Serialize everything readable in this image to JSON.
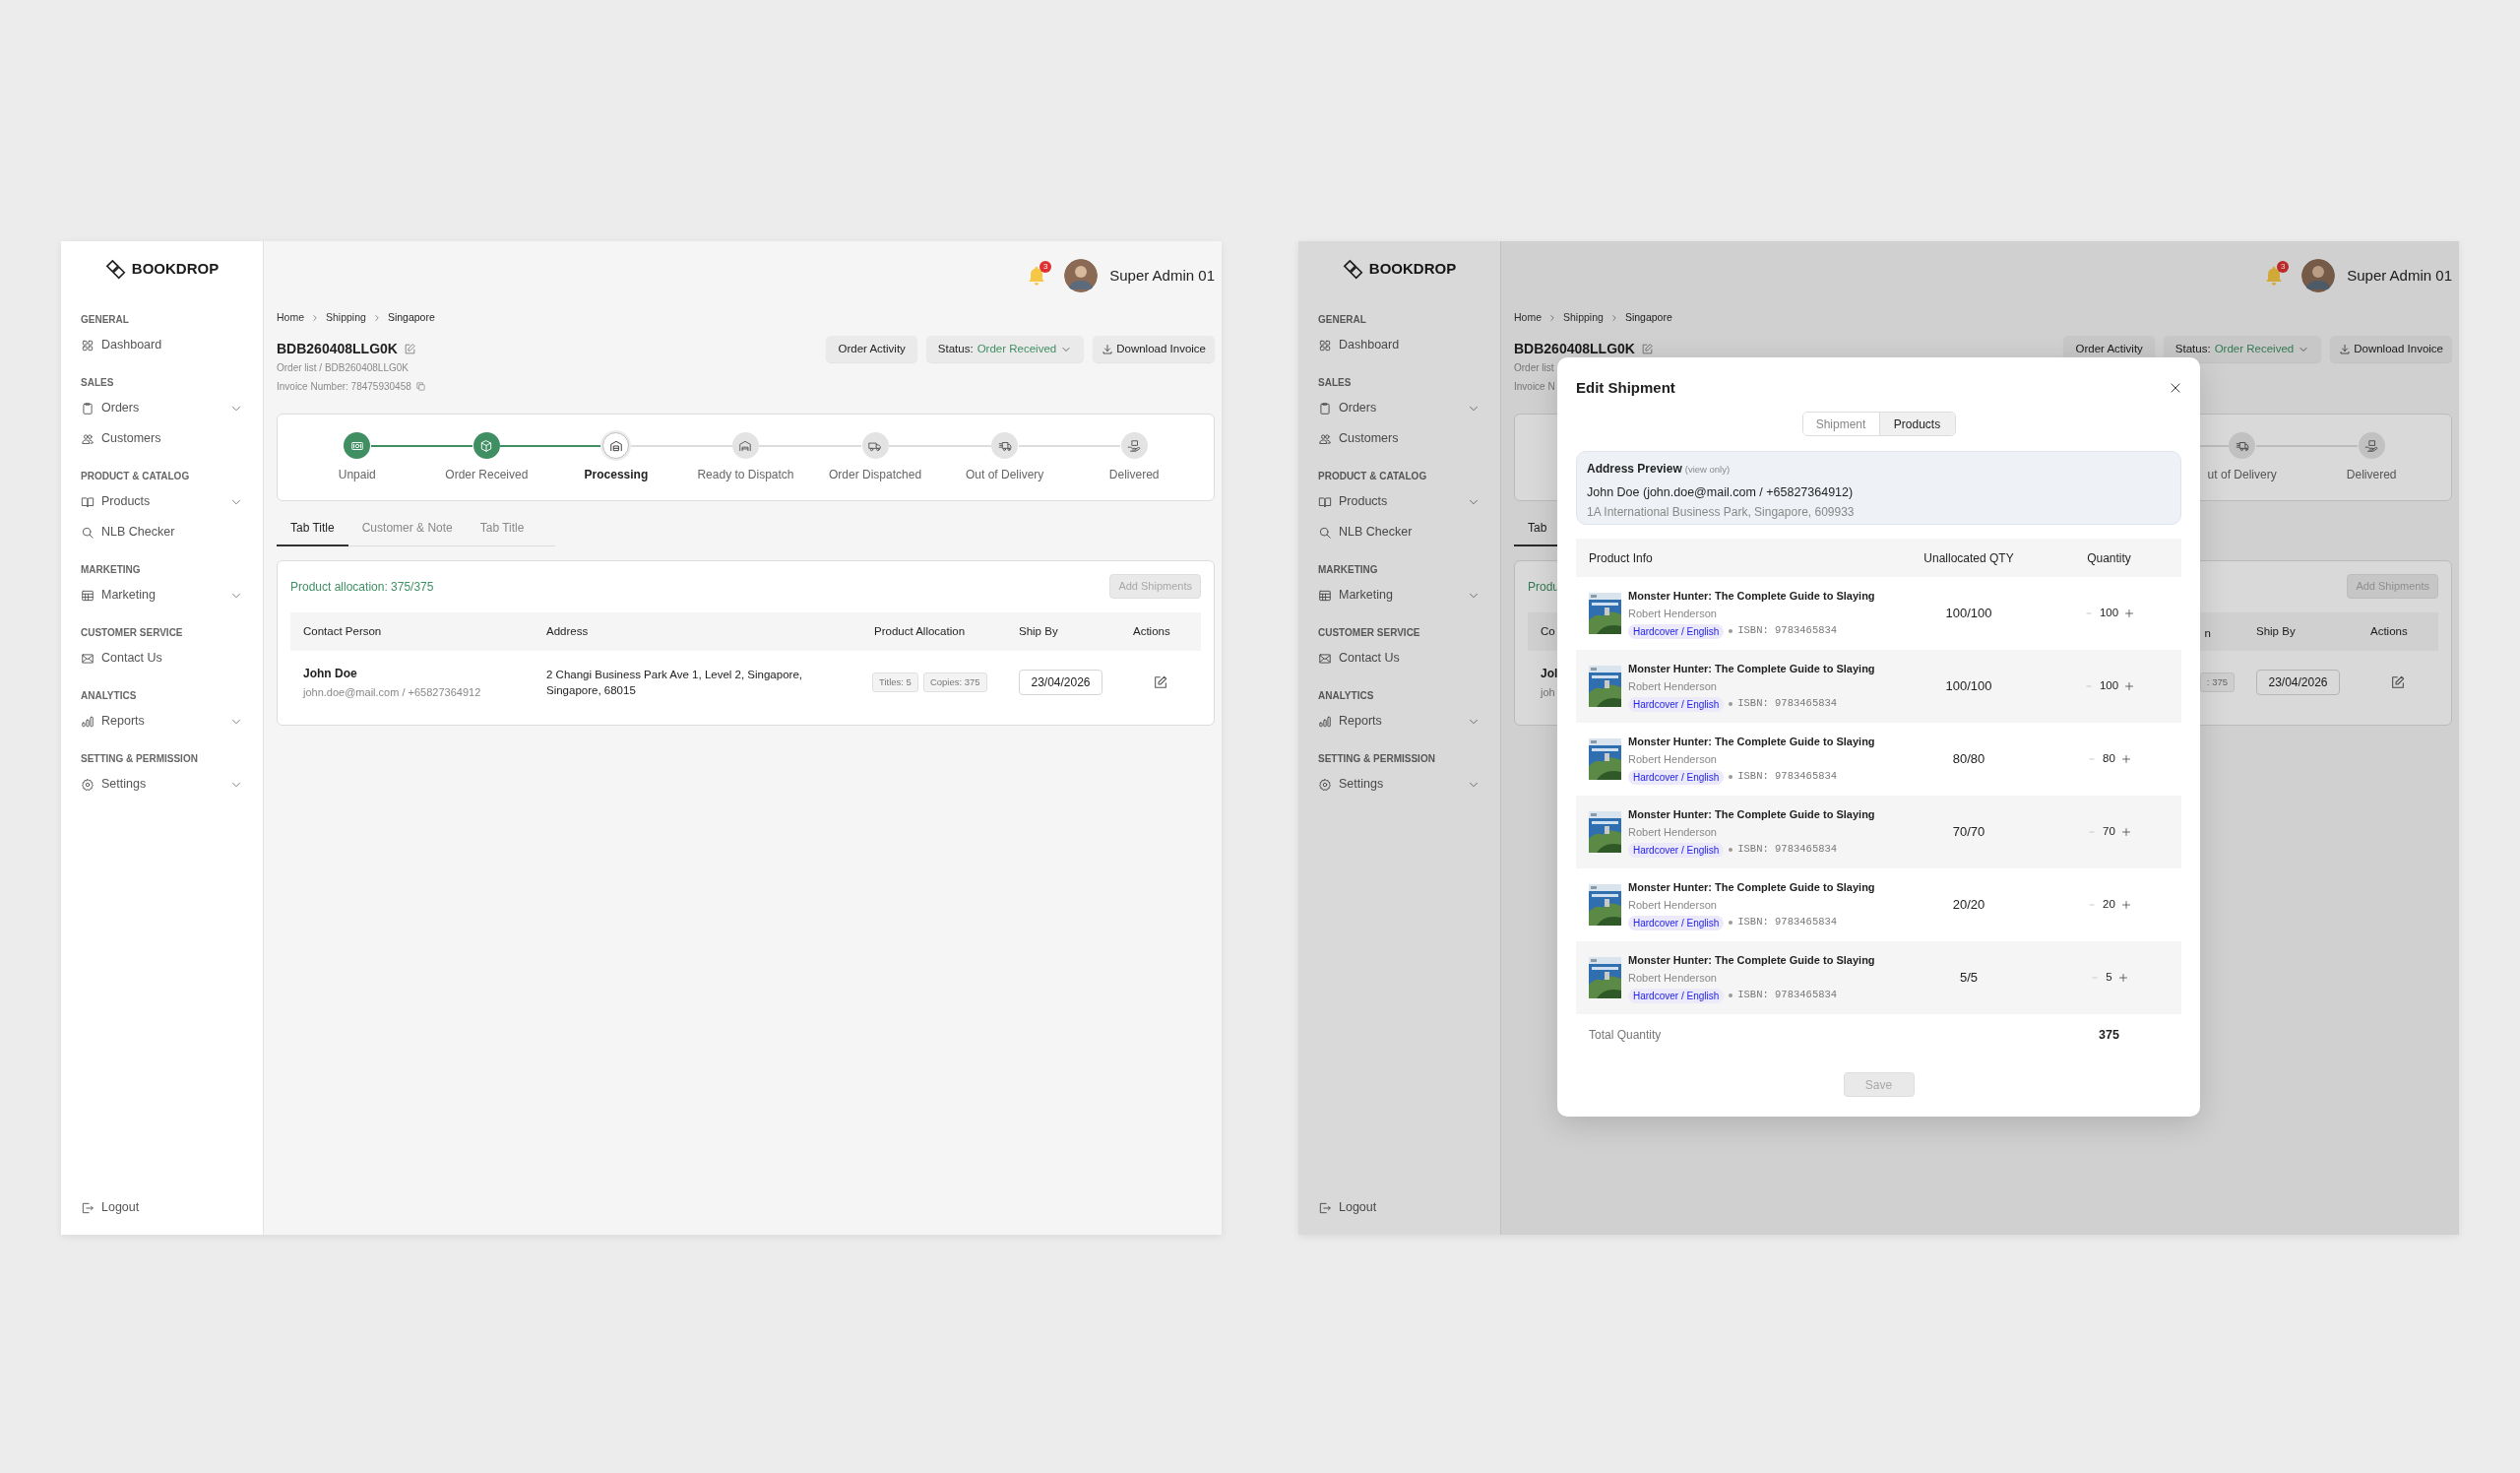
{
  "left_screen": {
    "sidebar": {
      "logo": "BOOKDROP",
      "sections": [
        {
          "title": "GENERAL",
          "items": [
            {
              "label": "Dashboard",
              "expandable": false
            }
          ]
        },
        {
          "title": "SALES",
          "items": [
            {
              "label": "Orders",
              "expandable": true
            },
            {
              "label": "Customers",
              "expandable": false
            }
          ]
        },
        {
          "title": "PRODUCT & CATALOG",
          "items": [
            {
              "label": "Products",
              "expandable": true
            },
            {
              "label": "NLB Checker",
              "expandable": false
            }
          ]
        },
        {
          "title": "MARKETING",
          "items": [
            {
              "label": "Marketing",
              "expandable": true
            }
          ]
        },
        {
          "title": "CUSTOMER SERVICE",
          "items": [
            {
              "label": "Contact Us",
              "expandable": false
            }
          ]
        },
        {
          "title": "ANALYTICS",
          "items": [
            {
              "label": "Reports",
              "expandable": true
            }
          ]
        },
        {
          "title": "SETTING & PERMISSION",
          "items": [
            {
              "label": "Settings",
              "expandable": true
            }
          ]
        }
      ],
      "logout": "Logout"
    },
    "header": {
      "notification_count": "3",
      "user_name": "Super Admin 01"
    },
    "breadcrumb": [
      "Home",
      "Shipping",
      "Singapore"
    ],
    "order": {
      "id": "BDB260408LLG0K",
      "path": "Order list / BDB260408LLG0K",
      "invoice": "Invoice Number: 78475930458"
    },
    "actions": {
      "order_activity": "Order Activity",
      "status_label": "Status:",
      "status_value": "Order Received",
      "download": "Download Invoice"
    },
    "steps": [
      {
        "label": "Unpaid",
        "completed": true,
        "active": false
      },
      {
        "label": "Order Received",
        "completed": true,
        "active": false
      },
      {
        "label": "Processing",
        "completed": false,
        "active": true
      },
      {
        "label": "Ready to Dispatch",
        "completed": false,
        "active": false
      },
      {
        "label": "Order Dispatched",
        "completed": false,
        "active": false
      },
      {
        "label": "Out of Delivery",
        "completed": false,
        "active": false
      },
      {
        "label": "Delivered",
        "completed": false,
        "active": false
      }
    ],
    "tabs": [
      {
        "label": "Tab Title",
        "selected": true
      },
      {
        "label": "Customer & Note",
        "selected": false
      },
      {
        "label": "Tab Title",
        "selected": false
      }
    ],
    "allocation": {
      "summary": "Product allocation: 375/375",
      "add_button": "Add Shipments",
      "add_disabled": true
    },
    "table": {
      "columns": [
        "Contact Person",
        "Address",
        "Product Allocation",
        "Ship By",
        "Actions"
      ],
      "rows": [
        {
          "name": "John Doe",
          "contact": "john.doe@mail.com / +65827364912",
          "address": "2 Changi Business Park Ave 1, Level 2, Singapore, Singapore, 68015",
          "titles": "Titles: 5",
          "copies": "Copies: 375",
          "ship_by": "23/04/2026"
        }
      ]
    }
  },
  "right_screen": {
    "sidebar": {
      "logo": "BOOKDROP",
      "sections": [
        {
          "title": "GENERAL",
          "items": [
            {
              "label": "Dashboard",
              "expandable": false
            }
          ]
        },
        {
          "title": "SALES",
          "items": [
            {
              "label": "Orders",
              "expandable": true
            },
            {
              "label": "Customers",
              "expandable": false
            }
          ]
        },
        {
          "title": "PRODUCT & CATALOG",
          "items": [
            {
              "label": "Products",
              "expandable": true
            },
            {
              "label": "NLB Checker",
              "expandable": false
            }
          ]
        },
        {
          "title": "MARKETING",
          "items": [
            {
              "label": "Marketing",
              "expandable": true
            }
          ]
        },
        {
          "title": "CUSTOMER SERVICE",
          "items": [
            {
              "label": "Contact Us",
              "expandable": false
            }
          ]
        },
        {
          "title": "ANALYTICS",
          "items": [
            {
              "label": "Reports",
              "expandable": true
            }
          ]
        },
        {
          "title": "SETTING & PERMISSION",
          "items": [
            {
              "label": "Settings",
              "expandable": true
            }
          ]
        }
      ],
      "logout": "Logout"
    },
    "header": {
      "notification_count": "3",
      "user_name": "Super Admin 01"
    },
    "breadcrumb": [
      "Home",
      "Shipping",
      "Singapore"
    ],
    "order": {
      "id": "BDB260408LLG0K",
      "path": "Order list",
      "invoice": "Invoice N"
    },
    "actions": {
      "order_activity": "Order Activity",
      "status_label": "Status:",
      "status_value": "Order Received",
      "download": "Download Invoice"
    },
    "steps": [
      {
        "label": "ut of Delivery",
        "completed": false,
        "active": false
      },
      {
        "label": "Delivered",
        "completed": false,
        "active": false
      }
    ],
    "tabs": [
      {
        "label": "Tab",
        "selected": true
      }
    ],
    "allocation": {
      "summary": "Produ",
      "add_button": "Add Shipments",
      "add_disabled": true
    },
    "table": {
      "columns": [
        "Co",
        "n",
        "Ship By",
        "Actions"
      ],
      "rows": [
        {
          "name": "Jol",
          "contact": "joh",
          "copies": ": 375",
          "ship_by": "23/04/2026"
        }
      ]
    },
    "modal": {
      "title": "Edit Shipment",
      "segments": [
        {
          "label": "Shipment",
          "selected": false
        },
        {
          "label": "Products",
          "selected": true
        }
      ],
      "address_preview": {
        "title": "Address Preview",
        "note": "(view only)",
        "contact": "John Doe (john.doe@mail.com / +65827364912)",
        "address": "1A International Business Park, Singapore, 609933"
      },
      "columns": [
        "Product Info",
        "Unallocated QTY",
        "Quantity"
      ],
      "products": [
        {
          "title": "Monster Hunter: The Complete Guide to Slaying",
          "author": "Robert Henderson",
          "format": "Hardcover / English",
          "isbn": "ISBN: 9783465834",
          "unallocated": "100/100",
          "quantity": "100"
        },
        {
          "title": "Monster Hunter: The Complete Guide to Slaying",
          "author": "Robert Henderson",
          "format": "Hardcover / English",
          "isbn": "ISBN: 9783465834",
          "unallocated": "100/100",
          "quantity": "100"
        },
        {
          "title": "Monster Hunter: The Complete Guide to Slaying",
          "author": "Robert Henderson",
          "format": "Hardcover / English",
          "isbn": "ISBN: 9783465834",
          "unallocated": "80/80",
          "quantity": "80"
        },
        {
          "title": "Monster Hunter: The Complete Guide to Slaying",
          "author": "Robert Henderson",
          "format": "Hardcover / English",
          "isbn": "ISBN: 9783465834",
          "unallocated": "70/70",
          "quantity": "70"
        },
        {
          "title": "Monster Hunter: The Complete Guide to Slaying",
          "author": "Robert Henderson",
          "format": "Hardcover / English",
          "isbn": "ISBN: 9783465834",
          "unallocated": "20/20",
          "quantity": "20"
        },
        {
          "title": "Monster Hunter: The Complete Guide to Slaying",
          "author": "Robert Henderson",
          "format": "Hardcover / English",
          "isbn": "ISBN: 9783465834",
          "unallocated": "5/5",
          "quantity": "5"
        }
      ],
      "total_label": "Total Quantity",
      "total": "375",
      "save": "Save",
      "save_disabled": true
    }
  }
}
